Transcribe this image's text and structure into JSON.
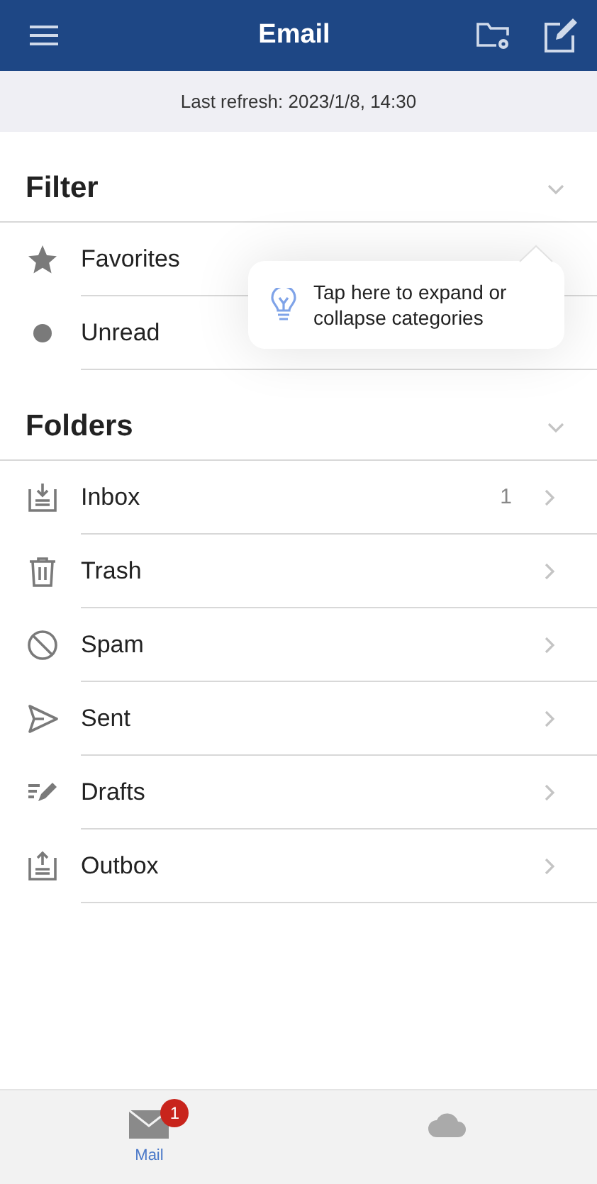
{
  "header": {
    "title": "Email"
  },
  "refresh": {
    "text": "Last refresh: 2023/1/8, 14:30"
  },
  "sections": [
    {
      "title": "Filter",
      "items": [
        {
          "kind": "star",
          "label": "Favorites"
        },
        {
          "kind": "dot",
          "label": "Unread"
        }
      ]
    },
    {
      "title": "Folders",
      "items": [
        {
          "kind": "inbox",
          "label": "Inbox",
          "count": "1"
        },
        {
          "kind": "trash",
          "label": "Trash"
        },
        {
          "kind": "spam",
          "label": "Spam"
        },
        {
          "kind": "sent",
          "label": "Sent"
        },
        {
          "kind": "drafts",
          "label": "Drafts"
        },
        {
          "kind": "outbox",
          "label": "Outbox"
        }
      ]
    }
  ],
  "tooltip": {
    "text": "Tap here to expand or collapse categories"
  },
  "tab_bar": [
    {
      "kind": "mail",
      "label": "Mail",
      "badge": "1",
      "selected": true
    },
    {
      "kind": "cloud",
      "selected": false
    }
  ]
}
